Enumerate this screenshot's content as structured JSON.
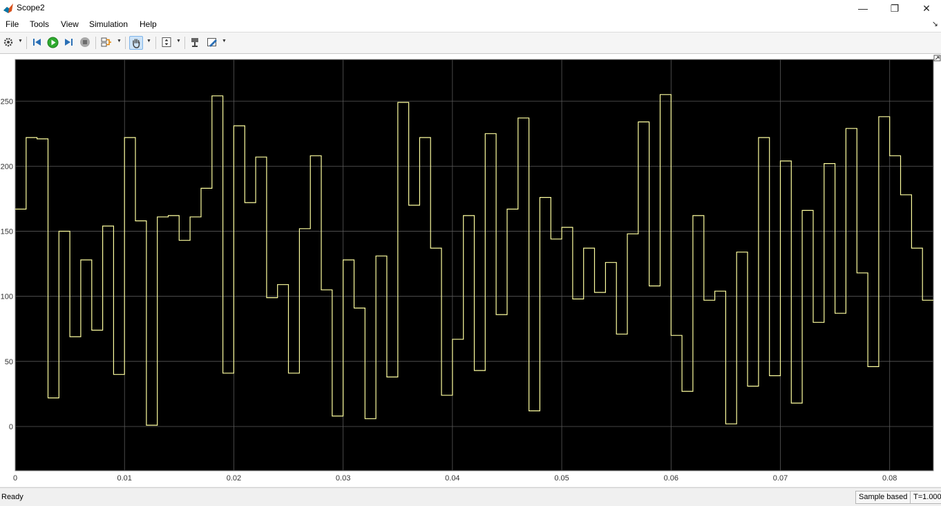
{
  "window": {
    "title": "Scope2",
    "minimize_glyph": "—",
    "restore_glyph": "❐",
    "close_glyph": "✕"
  },
  "menu": {
    "items": [
      "File",
      "Tools",
      "View",
      "Simulation",
      "Help"
    ],
    "corner_glyph": "↘"
  },
  "toolbar": {
    "icons": [
      "gear-icon",
      "step-back-icon",
      "run-icon",
      "step-forward-icon",
      "stop-icon",
      "signal-select-icon",
      "pan-hand-icon",
      "zoom-axes-icon",
      "highlight-block-icon",
      "style-pen-icon"
    ],
    "active": "pan-hand-icon",
    "colors": {
      "run": "#2eaa2e",
      "active_bg": "#cde3f7"
    }
  },
  "chart_data": {
    "type": "line",
    "step": true,
    "x_ticks": [
      "0",
      "0.01",
      "0.02",
      "0.03",
      "0.04",
      "0.05",
      "0.06",
      "0.07",
      "0.08"
    ],
    "y_ticks": [
      "0",
      "50",
      "100",
      "150",
      "200",
      "250"
    ],
    "xlim": [
      0,
      0.084
    ],
    "ylim": [
      -34,
      282
    ],
    "grid": true,
    "background": "#000000",
    "line_color": "#ffffa0",
    "sample_period": 0.001,
    "values": [
      167,
      222,
      221,
      22,
      150,
      69,
      128,
      74,
      154,
      40,
      222,
      158,
      1,
      161,
      162,
      143,
      161,
      183,
      254,
      41,
      231,
      172,
      207,
      99,
      109,
      41,
      152,
      208,
      105,
      8,
      128,
      91,
      6,
      131,
      38,
      249,
      170,
      222,
      137,
      24,
      67,
      162,
      43,
      225,
      86,
      167,
      237,
      12,
      176,
      144,
      153,
      98,
      137,
      103,
      126,
      71,
      148,
      234,
      108,
      255,
      70,
      27,
      162,
      97,
      104,
      2,
      134,
      31,
      222,
      39,
      204,
      18,
      166,
      80,
      202,
      87,
      229,
      118,
      46,
      238,
      208,
      178,
      137,
      97
    ]
  },
  "status": {
    "ready": "Ready",
    "mode": "Sample based",
    "time": "T=1.000"
  }
}
